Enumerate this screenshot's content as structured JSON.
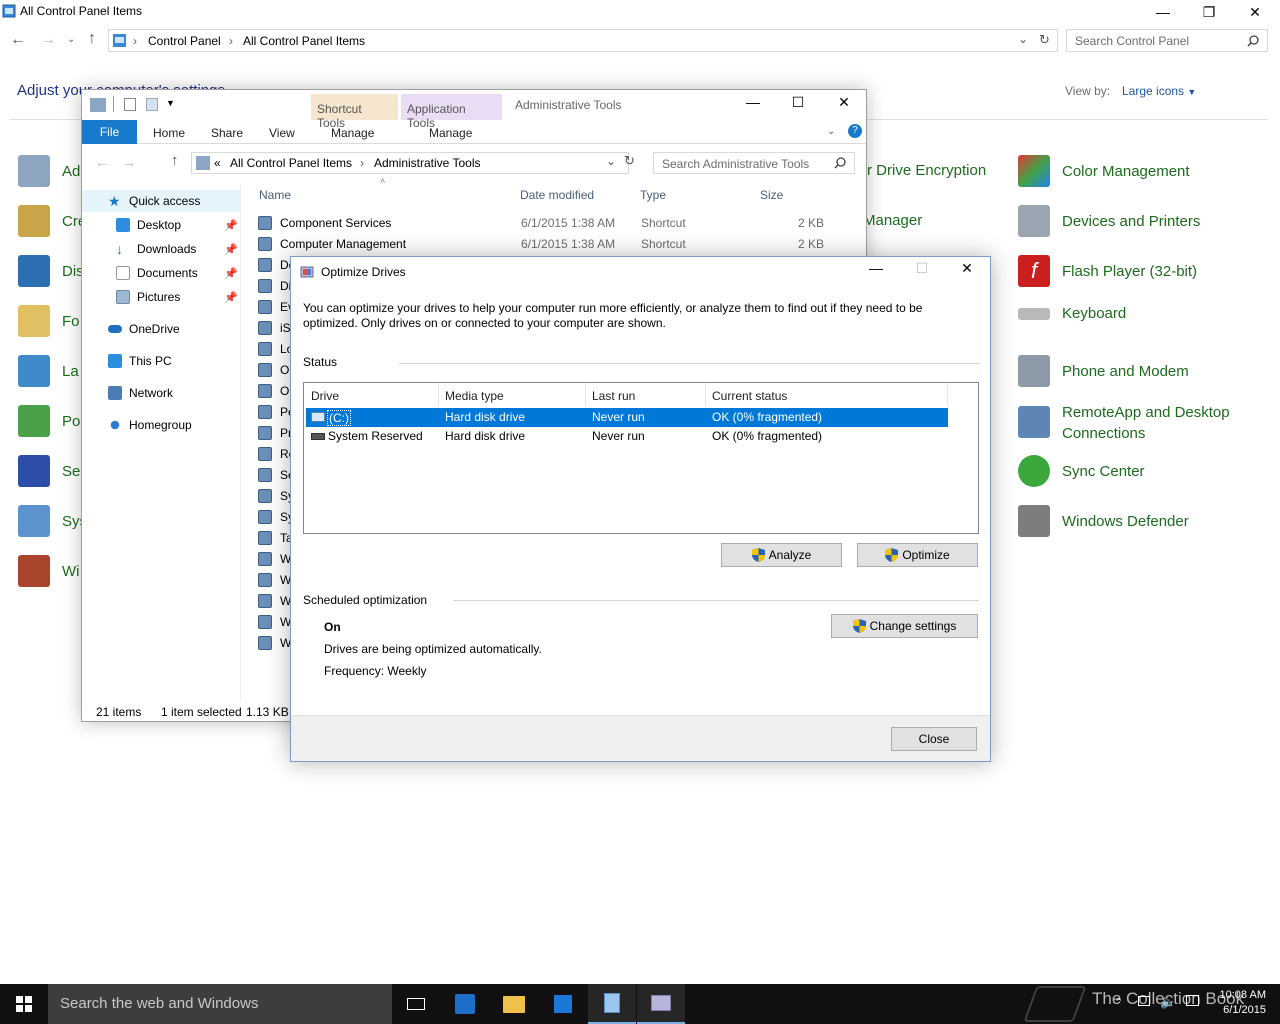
{
  "control_panel": {
    "window_title": "All Control Panel Items",
    "breadcrumb": [
      "Control Panel",
      "All Control Panel Items"
    ],
    "search_placeholder": "Search Control Panel",
    "heading": "Adjust your computer's settings",
    "view_by_label": "View by:",
    "view_by_value": "Large icons",
    "left_items": [
      "Ad",
      "Cre",
      "Dis",
      "Fo",
      "La",
      "Po",
      "Se",
      "Sys",
      "Wi"
    ],
    "middle_items": [
      "r Drive Encryption",
      "Manager"
    ],
    "right_items": [
      "Color Management",
      "Devices and Printers",
      "Flash Player (32-bit)",
      "Keyboard",
      "Phone and Modem",
      "RemoteApp and Desktop Connections",
      "Sync Center",
      "Windows Defender"
    ]
  },
  "explorer": {
    "context_tabs": [
      "Shortcut Tools",
      "Application Tools"
    ],
    "window_title": "Administrative Tools",
    "ribbon_tabs": [
      "File",
      "Home",
      "Share",
      "View",
      "Manage",
      "Manage"
    ],
    "breadcrumb": [
      "All Control Panel Items",
      "Administrative Tools"
    ],
    "search_placeholder": "Search Administrative Tools",
    "nav": [
      "Quick access",
      "Desktop",
      "Downloads",
      "Documents",
      "Pictures",
      "OneDrive",
      "This PC",
      "Network",
      "Homegroup"
    ],
    "columns": [
      "Name",
      "Date modified",
      "Type",
      "Size"
    ],
    "files": [
      {
        "name": "Component Services",
        "date": "6/1/2015 1:38 AM",
        "type": "Shortcut",
        "size": "2 KB"
      },
      {
        "name": "Computer Management",
        "date": "6/1/2015 1:38 AM",
        "type": "Shortcut",
        "size": "2 KB"
      }
    ],
    "partial_files": [
      "De",
      "Di",
      "Ev",
      "iS",
      "Lo",
      "O",
      "O",
      "Pe",
      "Pr",
      "Re",
      "Se",
      "Sy",
      "Sy",
      "Ta",
      "W",
      "W",
      "W",
      "W",
      "W"
    ],
    "status_items": "21 items",
    "status_selected": "1 item selected",
    "status_size": "1.13 KB"
  },
  "dialog": {
    "title": "Optimize Drives",
    "description": "You can optimize your drives to help your computer run more efficiently, or analyze them to find out if they need to be optimized. Only drives on or connected to your computer are shown.",
    "status_label": "Status",
    "columns": [
      "Drive",
      "Media type",
      "Last run",
      "Current status"
    ],
    "drives": [
      {
        "drive": "(C:)",
        "media": "Hard disk drive",
        "last_run": "Never run",
        "status": "OK (0% fragmented)"
      },
      {
        "drive": "System Reserved",
        "media": "Hard disk drive",
        "last_run": "Never run",
        "status": "OK (0% fragmented)"
      }
    ],
    "analyze_label": "Analyze",
    "optimize_label": "Optimize",
    "scheduled_label": "Scheduled optimization",
    "schedule_state": "On",
    "schedule_desc": "Drives are being optimized automatically.",
    "frequency": "Frequency: Weekly",
    "change_settings_label": "Change settings",
    "close_label": "Close"
  },
  "taskbar": {
    "search_placeholder": "Search the web and Windows",
    "time": "10:08 AM",
    "date": "6/1/2015",
    "watermark": "The Collection Book"
  }
}
